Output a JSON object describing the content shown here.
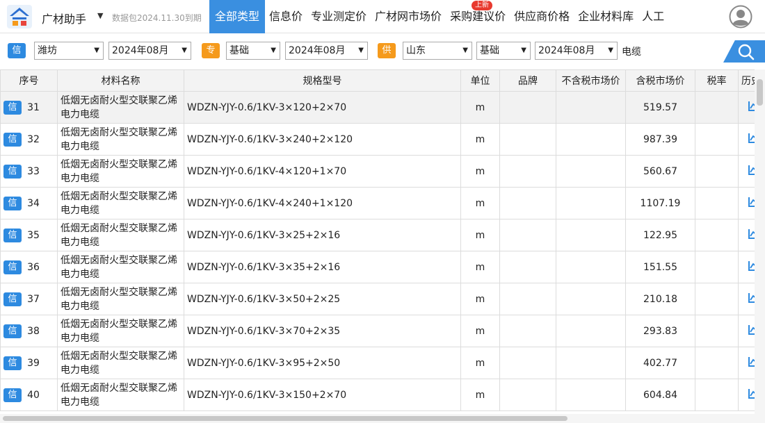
{
  "app": {
    "title": "广材助手",
    "package_info": "数据包2024.11.30到期"
  },
  "nav": {
    "tabs": [
      "全部类型",
      "信息价",
      "专业测定价",
      "广材网市场价",
      "采购建议价",
      "供应商价格",
      "企业材料库",
      "人工"
    ],
    "new_badge": "上新"
  },
  "filters": {
    "tag_info": "信",
    "region_1": "潍坊",
    "period_1": "2024年08月",
    "tag_special": "专",
    "basis_1": "基础",
    "period_2": "2024年08月",
    "tag_supply": "供",
    "region_2": "山东",
    "basis_2": "基础",
    "period_3": "2024年08月",
    "search_value": "电缆"
  },
  "table": {
    "headers": [
      "序号",
      "材料名称",
      "规格型号",
      "单位",
      "品牌",
      "不含税市场价",
      "含税市场价",
      "税率",
      "历史"
    ],
    "row_tag": "信",
    "rows": [
      {
        "idx": "31",
        "name": "低烟无卤耐火型交联聚乙烯电力电缆",
        "spec": "WDZN-YJY-0.6/1KV-3×120+2×70",
        "unit": "m",
        "price": "519.57"
      },
      {
        "idx": "32",
        "name": "低烟无卤耐火型交联聚乙烯电力电缆",
        "spec": "WDZN-YJY-0.6/1KV-3×240+2×120",
        "unit": "m",
        "price": "987.39"
      },
      {
        "idx": "33",
        "name": "低烟无卤耐火型交联聚乙烯电力电缆",
        "spec": "WDZN-YJY-0.6/1KV-4×120+1×70",
        "unit": "m",
        "price": "560.67"
      },
      {
        "idx": "34",
        "name": "低烟无卤耐火型交联聚乙烯电力电缆",
        "spec": "WDZN-YJY-0.6/1KV-4×240+1×120",
        "unit": "m",
        "price": "1107.19"
      },
      {
        "idx": "35",
        "name": "低烟无卤耐火型交联聚乙烯电力电缆",
        "spec": "WDZN-YJY-0.6/1KV-3×25+2×16",
        "unit": "m",
        "price": "122.95"
      },
      {
        "idx": "36",
        "name": "低烟无卤耐火型交联聚乙烯电力电缆",
        "spec": "WDZN-YJY-0.6/1KV-3×35+2×16",
        "unit": "m",
        "price": "151.55"
      },
      {
        "idx": "37",
        "name": "低烟无卤耐火型交联聚乙烯电力电缆",
        "spec": "WDZN-YJY-0.6/1KV-3×50+2×25",
        "unit": "m",
        "price": "210.18"
      },
      {
        "idx": "38",
        "name": "低烟无卤耐火型交联聚乙烯电力电缆",
        "spec": "WDZN-YJY-0.6/1KV-3×70+2×35",
        "unit": "m",
        "price": "293.83"
      },
      {
        "idx": "39",
        "name": "低烟无卤耐火型交联聚乙烯电力电缆",
        "spec": "WDZN-YJY-0.6/1KV-3×95+2×50",
        "unit": "m",
        "price": "402.77"
      },
      {
        "idx": "40",
        "name": "低烟无卤耐火型交联聚乙烯电力电缆",
        "spec": "WDZN-YJY-0.6/1KV-3×150+2×70",
        "unit": "m",
        "price": "604.84"
      }
    ]
  },
  "colors": {
    "accent": "#3a8fe0",
    "tag_blue": "#2d8ae0",
    "tag_orange": "#f59a1c",
    "badge_red": "#e83a2f"
  },
  "icons": {
    "logo": "guangcai-logo-icon",
    "avatar": "user-avatar-icon",
    "search": "search-icon",
    "history": "history-chart-icon"
  }
}
